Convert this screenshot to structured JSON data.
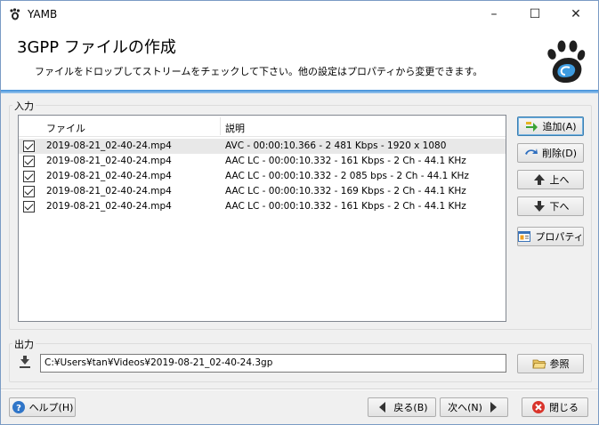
{
  "window": {
    "title": "YAMB",
    "minimize": "–",
    "maximize": "☐",
    "close": "✕"
  },
  "header": {
    "title": "3GPP ファイルの作成",
    "description": "ファイルをドロップしてストリームをチェックして下さい。他の設定はプロパティから変更できます。"
  },
  "input_group": {
    "label": "入力",
    "columns": [
      "ファイル",
      "説明"
    ],
    "rows": [
      {
        "file": "2019-08-21_02-40-24.mp4",
        "desc": "AVC - 00:00:10.366 - 2 481 Kbps - 1920 x 1080",
        "checked": true
      },
      {
        "file": "2019-08-21_02-40-24.mp4",
        "desc": "AAC LC - 00:00:10.332 - 161 Kbps - 2 Ch - 44.1 KHz",
        "checked": true
      },
      {
        "file": "2019-08-21_02-40-24.mp4",
        "desc": "AAC LC - 00:00:10.332 - 2 085 bps - 2 Ch - 44.1 KHz",
        "checked": true
      },
      {
        "file": "2019-08-21_02-40-24.mp4",
        "desc": "AAC LC - 00:00:10.332 - 169 Kbps - 2 Ch - 44.1 KHz",
        "checked": true
      },
      {
        "file": "2019-08-21_02-40-24.mp4",
        "desc": "AAC LC - 00:00:10.332 - 161 Kbps - 2 Ch - 44.1 KHz",
        "checked": true
      }
    ]
  },
  "side_buttons": {
    "add": "追加(A)",
    "delete": "削除(D)",
    "up": "上へ",
    "down": "下へ",
    "properties": "プロパティ"
  },
  "output_group": {
    "label": "出力",
    "path": "C:¥Users¥tan¥Videos¥2019-08-21_02-40-24.3gp",
    "browse": "参照"
  },
  "footer": {
    "help": "ヘルプ(H)",
    "back": "戻る(B)",
    "next": "次へ(N)",
    "close": "閉じる"
  },
  "colors": {
    "accent_blue": "#1f6fc5",
    "header_rule": "#3a8dd8",
    "selected_row": "#e8e8e8"
  }
}
